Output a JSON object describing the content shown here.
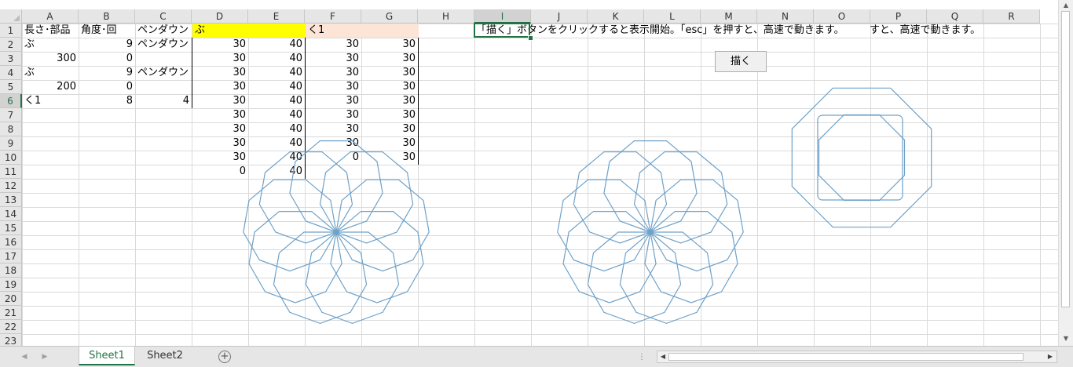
{
  "columns": [
    "A",
    "B",
    "C",
    "D",
    "E",
    "F",
    "G",
    "H",
    "I",
    "J",
    "K",
    "L",
    "M",
    "N",
    "O",
    "P",
    "Q",
    "R"
  ],
  "rows": [
    "1",
    "2",
    "3",
    "4",
    "5",
    "6",
    "7",
    "8",
    "9",
    "10",
    "11",
    "12",
    "13",
    "14",
    "15",
    "16",
    "17",
    "18",
    "19",
    "20",
    "21",
    "22",
    "23"
  ],
  "selected_column": "I",
  "selected_row": "6",
  "cells": {
    "r1": {
      "a": "長さ･部品",
      "b": "角度･回",
      "c": "ペンダウン",
      "d": "ぶ",
      "f": "く1",
      "i": "「描く」ボタンをクリックすると表示開始。「esc」を押すと、高速で動きます。",
      "p": "すと、高速で動きます。"
    },
    "r2": {
      "a": "ぶ",
      "b": "9",
      "c": "ペンダウン",
      "d": "30",
      "e": "40",
      "f": "30",
      "g": "30"
    },
    "r3": {
      "a": "300",
      "b": "0",
      "d": "30",
      "e": "40",
      "f": "30",
      "g": "30"
    },
    "r4": {
      "a": "ぶ",
      "b": "9",
      "c": "ペンダウン",
      "d": "30",
      "e": "40",
      "f": "30",
      "g": "30"
    },
    "r5": {
      "a": "200",
      "b": "0",
      "d": "30",
      "e": "40",
      "f": "30",
      "g": "30"
    },
    "r6": {
      "a": "く1",
      "b": "8",
      "c": "4",
      "d": "30",
      "e": "40",
      "f": "30",
      "g": "30"
    },
    "r7": {
      "d": "30",
      "e": "40",
      "f": "30",
      "g": "30"
    },
    "r8": {
      "d": "30",
      "e": "40",
      "f": "30",
      "g": "30"
    },
    "r9": {
      "d": "30",
      "e": "40",
      "f": "30",
      "g": "30"
    },
    "r10": {
      "d": "30",
      "e": "40",
      "f": "0",
      "g": "30"
    },
    "r11": {
      "d": "0",
      "e": "40"
    }
  },
  "button": {
    "label": "描く"
  },
  "tabs": [
    "Sheet1",
    "Sheet2"
  ],
  "active_tab": "Sheet1",
  "add_sheet_label": "+",
  "figure_color": "#6fa2c9",
  "highlight_colors": {
    "d1": "#ffff00",
    "f1": "#fce4d6"
  },
  "accent_color": "#217346"
}
